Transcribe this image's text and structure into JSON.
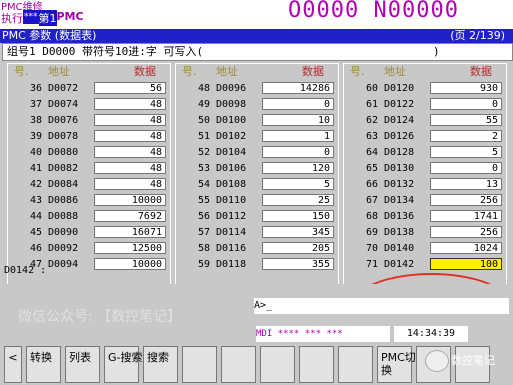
{
  "header": {
    "mode_title": "PMC维修",
    "exec_label": "执行",
    "indicator": "***",
    "pmc_label_hl": "第1",
    "pmc_label": "PMC",
    "o_number": "O0000",
    "n_number": "N00000"
  },
  "title_bar": {
    "title": "PMC 参数 (数据表)",
    "page": "(页   2/139)"
  },
  "group_row": {
    "text": "组号1   D0000 带符号10进:字 可写入(",
    "end": ")"
  },
  "columns": [
    {
      "headers": {
        "no": "号.",
        "addr": "地址",
        "data": "数据"
      },
      "rows": [
        {
          "no": "36",
          "addr": "D0072",
          "value": "56"
        },
        {
          "no": "37",
          "addr": "D0074",
          "value": "48"
        },
        {
          "no": "38",
          "addr": "D0076",
          "value": "48"
        },
        {
          "no": "39",
          "addr": "D0078",
          "value": "48"
        },
        {
          "no": "40",
          "addr": "D0080",
          "value": "48"
        },
        {
          "no": "41",
          "addr": "D0082",
          "value": "48"
        },
        {
          "no": "42",
          "addr": "D0084",
          "value": "48"
        },
        {
          "no": "43",
          "addr": "D0086",
          "value": "10000"
        },
        {
          "no": "44",
          "addr": "D0088",
          "value": "7692"
        },
        {
          "no": "45",
          "addr": "D0090",
          "value": "16071"
        },
        {
          "no": "46",
          "addr": "D0092",
          "value": "12500"
        },
        {
          "no": "47",
          "addr": "D0094",
          "value": "10000"
        }
      ]
    },
    {
      "headers": {
        "no": "号.",
        "addr": "地址",
        "data": "数据"
      },
      "rows": [
        {
          "no": "48",
          "addr": "D0096",
          "value": "14286"
        },
        {
          "no": "49",
          "addr": "D0098",
          "value": "0"
        },
        {
          "no": "50",
          "addr": "D0100",
          "value": "10"
        },
        {
          "no": "51",
          "addr": "D0102",
          "value": "1"
        },
        {
          "no": "52",
          "addr": "D0104",
          "value": "0"
        },
        {
          "no": "53",
          "addr": "D0106",
          "value": "120"
        },
        {
          "no": "54",
          "addr": "D0108",
          "value": "5"
        },
        {
          "no": "55",
          "addr": "D0110",
          "value": "25"
        },
        {
          "no": "56",
          "addr": "D0112",
          "value": "150"
        },
        {
          "no": "57",
          "addr": "D0114",
          "value": "345"
        },
        {
          "no": "58",
          "addr": "D0116",
          "value": "205"
        },
        {
          "no": "59",
          "addr": "D0118",
          "value": "355"
        }
      ]
    },
    {
      "headers": {
        "no": "号.",
        "addr": "地址",
        "data": "数据"
      },
      "rows": [
        {
          "no": "60",
          "addr": "D0120",
          "value": "930"
        },
        {
          "no": "61",
          "addr": "D0122",
          "value": "0"
        },
        {
          "no": "62",
          "addr": "D0124",
          "value": "55"
        },
        {
          "no": "63",
          "addr": "D0126",
          "value": "2"
        },
        {
          "no": "64",
          "addr": "D0128",
          "value": "5"
        },
        {
          "no": "65",
          "addr": "D0130",
          "value": "0"
        },
        {
          "no": "66",
          "addr": "D0132",
          "value": "13"
        },
        {
          "no": "67",
          "addr": "D0134",
          "value": "256"
        },
        {
          "no": "68",
          "addr": "D0136",
          "value": "1741"
        },
        {
          "no": "69",
          "addr": "D0138",
          "value": "256"
        },
        {
          "no": "70",
          "addr": "D0140",
          "value": "1024"
        },
        {
          "no": "71",
          "addr": "D0142",
          "value": "100",
          "selected": true
        }
      ]
    }
  ],
  "key_in": "D0142 :",
  "watermark": "微信公众号: 【数控笔记】",
  "prompt": "A>_",
  "status": {
    "mode": "MDI  **** *** ***",
    "time": "14:34:39"
  },
  "softkeys": [
    "<",
    "转换",
    "列表",
    "G-搜索",
    "搜索",
    "",
    "",
    "",
    "",
    "",
    "PMC切\n换",
    "",
    ""
  ],
  "wechat_label": "数控笔记",
  "colors": {
    "title_bar": "#2022c8",
    "highlight": "#fff000",
    "header_text": "#b000b0",
    "annotation_circle": "#e03020"
  }
}
